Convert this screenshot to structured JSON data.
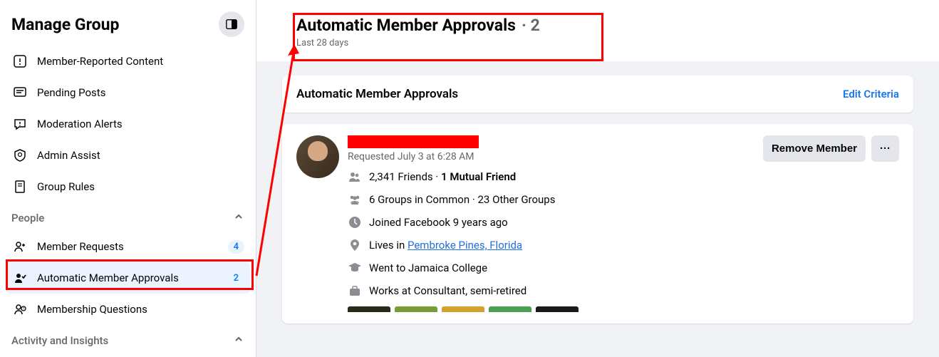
{
  "sidebar": {
    "title": "Manage Group",
    "nav": [
      {
        "label": "Member-Reported Content"
      },
      {
        "label": "Pending Posts"
      },
      {
        "label": "Moderation Alerts"
      },
      {
        "label": "Admin Assist"
      },
      {
        "label": "Group Rules"
      }
    ],
    "sections": [
      {
        "title": "People",
        "items": [
          {
            "label": "Member Requests",
            "badge": "4"
          },
          {
            "label": "Automatic Member Approvals",
            "badge": "2"
          },
          {
            "label": "Membership Questions"
          }
        ]
      },
      {
        "title": "Activity and Insights"
      }
    ]
  },
  "page": {
    "title": "Automatic Member Approvals",
    "count": "· 2",
    "subtitle": "Last 28 days"
  },
  "card": {
    "title": "Automatic Member Approvals",
    "editLabel": "Edit Criteria"
  },
  "member": {
    "requested": "Requested July 3 at 6:28 AM",
    "friends": "2,341 Friends · ",
    "mutual": "1 Mutual Friend",
    "groups": "6 Groups in Common · 23 Other Groups",
    "joined": "Joined Facebook 9 years ago",
    "livesPrefix": "Lives in ",
    "livesLink": "Pembroke Pines, Florida",
    "education": "Went to Jamaica College",
    "work": "Works at Consultant, semi-retired",
    "removeLabel": "Remove Member",
    "moreLabel": "···"
  }
}
